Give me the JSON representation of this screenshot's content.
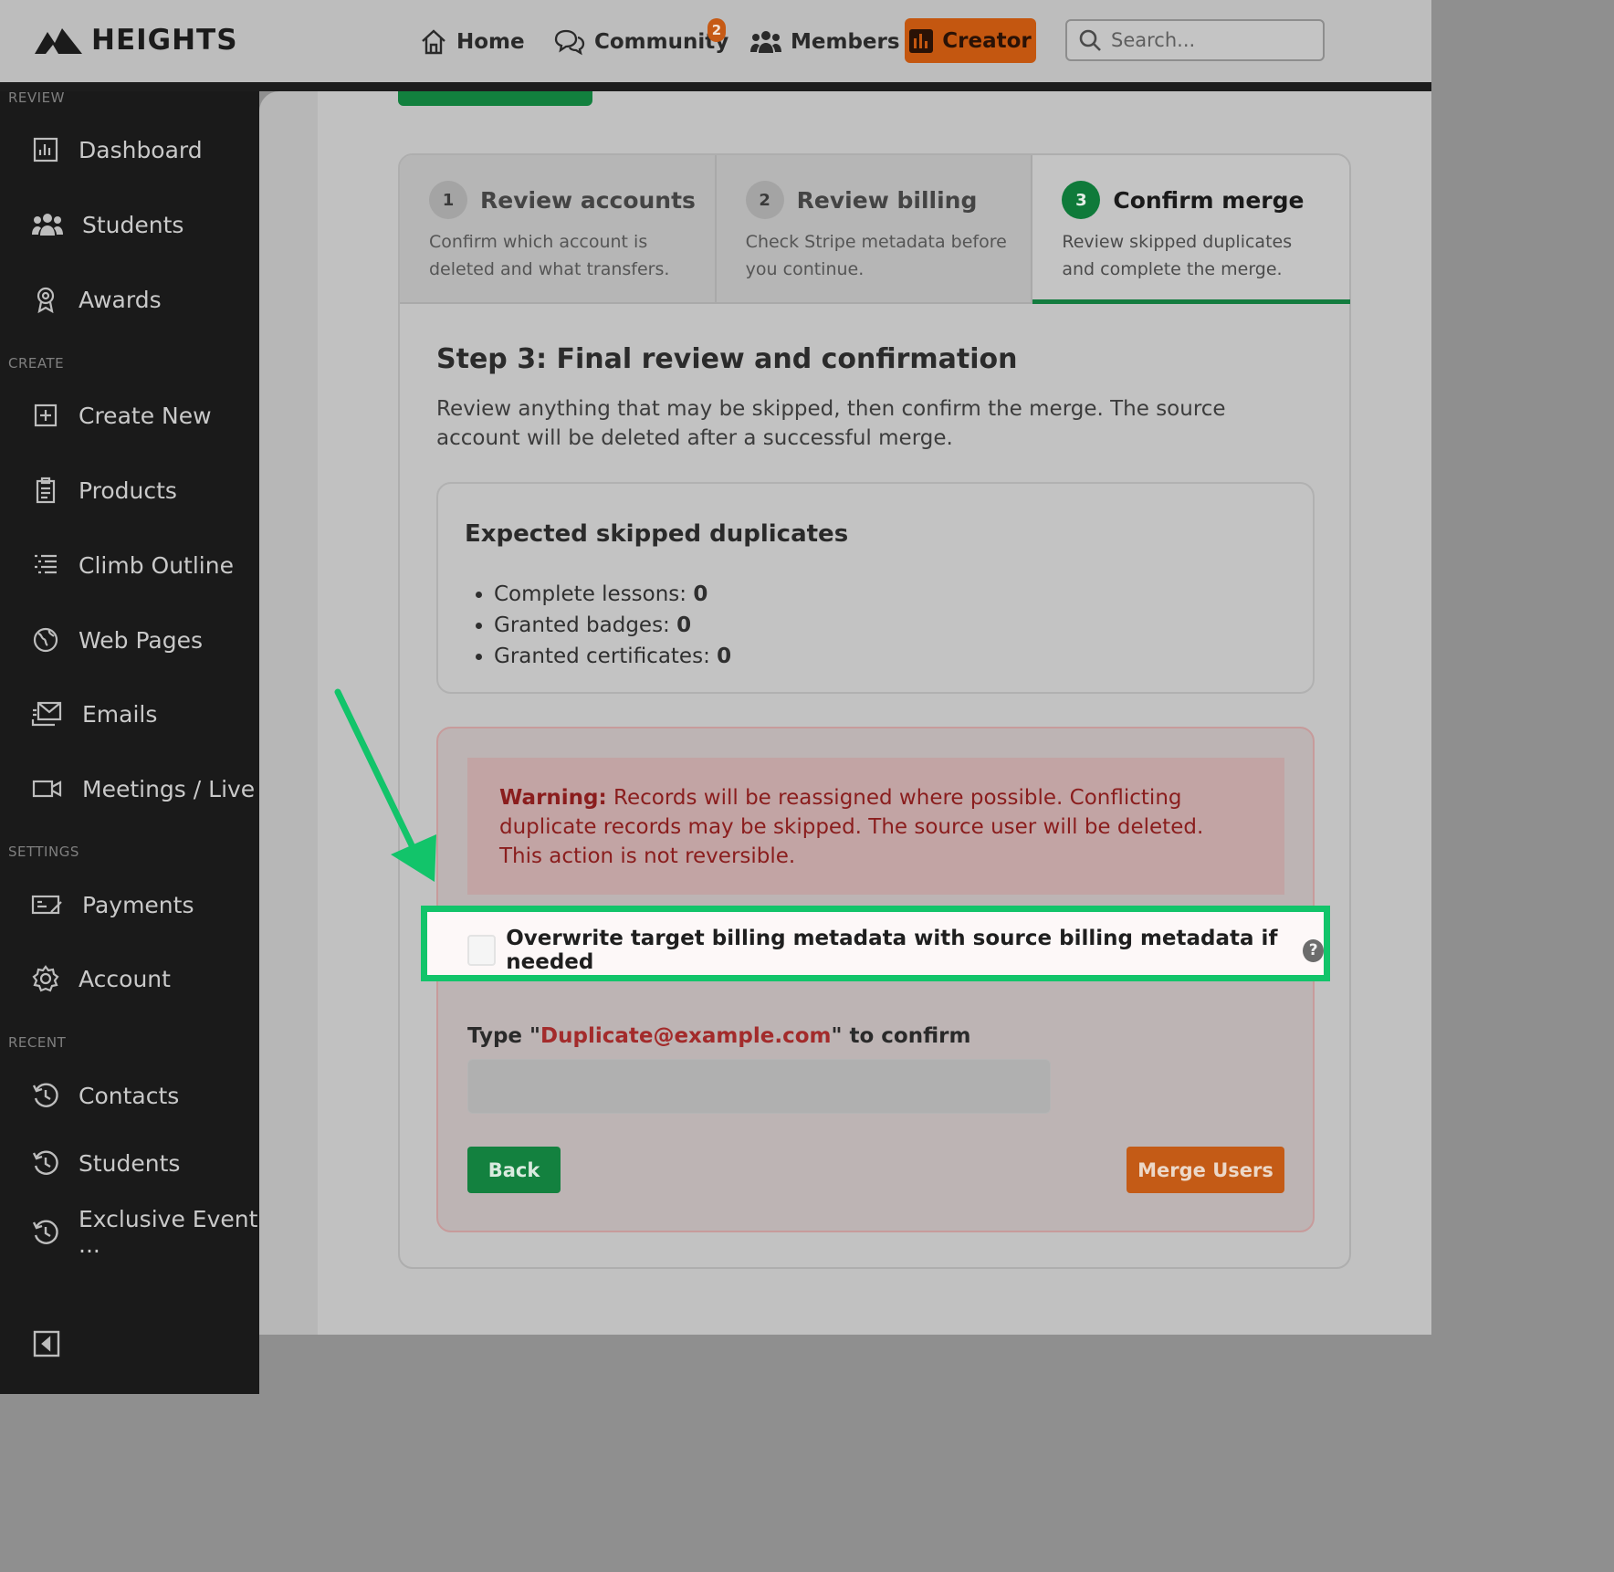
{
  "brand": {
    "name": "HEIGHTS"
  },
  "topnav": {
    "items": [
      {
        "label": "Home",
        "icon": "home-icon"
      },
      {
        "label": "Community",
        "icon": "chat-bubbles-icon",
        "badge": "2"
      },
      {
        "label": "Members",
        "icon": "members-icon"
      },
      {
        "label": "Creator",
        "icon": "bar-chart-icon"
      }
    ],
    "search": {
      "placeholder": "Search..."
    }
  },
  "sidebar": {
    "sections": [
      {
        "label": "REVIEW",
        "items": [
          {
            "label": "Dashboard",
            "icon": "dashboard-icon"
          },
          {
            "label": "Students",
            "icon": "students-icon"
          },
          {
            "label": "Awards",
            "icon": "award-icon"
          }
        ]
      },
      {
        "label": "CREATE",
        "items": [
          {
            "label": "Create New",
            "icon": "plus-square-icon"
          },
          {
            "label": "Products",
            "icon": "clipboard-icon"
          },
          {
            "label": "Climb Outline",
            "icon": "outline-list-icon"
          },
          {
            "label": "Web Pages",
            "icon": "globe-icon"
          },
          {
            "label": "Emails",
            "icon": "email-icon"
          },
          {
            "label": "Meetings / Live",
            "icon": "video-icon"
          }
        ]
      },
      {
        "label": "SETTINGS",
        "items": [
          {
            "label": "Payments",
            "icon": "payments-icon"
          },
          {
            "label": "Account",
            "icon": "gear-icon"
          }
        ]
      },
      {
        "label": "RECENT",
        "items": [
          {
            "label": "Contacts",
            "icon": "history-icon"
          },
          {
            "label": "Students",
            "icon": "history-icon"
          },
          {
            "label": "Exclusive Event",
            "label2": "...",
            "icon": "history-icon"
          }
        ]
      }
    ]
  },
  "wizard": {
    "steps": [
      {
        "num": "1",
        "title": "Review accounts",
        "desc": "Confirm which account is deleted and what transfers.",
        "active": false
      },
      {
        "num": "2",
        "title": "Review billing",
        "desc": "Check Stripe metadata before you continue.",
        "active": false
      },
      {
        "num": "3",
        "title": "Confirm merge",
        "desc": "Review skipped duplicates and complete the merge.",
        "active": true
      }
    ],
    "step3": {
      "title": "Step 3: Final review and confirmation",
      "desc": "Review anything that may be skipped, then confirm the merge. The source account will be deleted after a successful merge."
    },
    "duplicates": {
      "title": "Expected skipped duplicates",
      "items": [
        {
          "label": "Complete lessons: ",
          "value": "0"
        },
        {
          "label": "Granted badges: ",
          "value": "0"
        },
        {
          "label": "Granted certificates: ",
          "value": "0"
        }
      ]
    },
    "warning": {
      "prefix": "Warning:",
      "text": " Records will be reassigned where possible. Conflicting duplicate records may be skipped. The source user will be deleted. This action is not reversible."
    },
    "overwrite": {
      "label": "Overwrite target billing metadata with source billing metadata if needed",
      "checked": false,
      "help": "?"
    },
    "confirm": {
      "prefix": "Type \"",
      "email": "Duplicate@example.com",
      "suffix": "\" to confirm",
      "value": ""
    },
    "back_label": "Back",
    "merge_label": "Merge Users"
  },
  "colors": {
    "accent_green": "#13813f",
    "accent_orange": "#c45710",
    "highlight": "#12c46a",
    "warning_text": "#8a1d1d"
  }
}
